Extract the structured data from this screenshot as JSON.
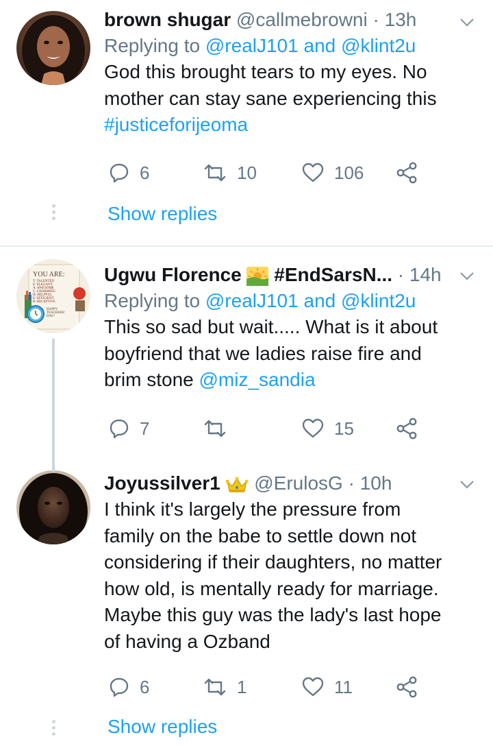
{
  "tweets": [
    {
      "name": "brown shugar",
      "handle": "@callmebrowni",
      "dot": "·",
      "time": "13h",
      "replying_prefix": "Replying to",
      "replying_mention_1": "@realJ101",
      "replying_and": "and",
      "replying_mention_2": "@klint2u",
      "text_1": "God this brought tears to my eyes. No",
      "text_2": "mother can stay sane experiencing this",
      "hashtag": "#justiceforijeoma",
      "replies": "6",
      "retweets": "10",
      "likes": "106",
      "show_replies": "Show replies"
    },
    {
      "name": "Ugwu Florence",
      "name_hashtag": "#EndSarsN...",
      "dot": "·",
      "time": "14h",
      "replying_prefix": "Replying to",
      "replying_mention_1": "@realJ101",
      "replying_and": "and",
      "replying_mention_2": "@klint2u",
      "text_1": "This so sad but wait..... What is it about",
      "text_2": "boyfriend that we ladies raise fire and",
      "text_3": "brim stone",
      "mention": "@miz_sandia",
      "replies": "7",
      "retweets": "",
      "likes": "15",
      "avatar_text": {
        "heading": "YOU ARE:",
        "lines": [
          "T: TALENTED",
          "E: ELEGANT",
          "A: AWESOME",
          "C: CHARMING",
          "H: HELPFUL",
          "E: EFFICIENT",
          "R: RECEPTIVE"
        ],
        "footer_1": "HAPPY",
        "footer_2": "TEACHERS'",
        "footer_3": "DAY!"
      }
    },
    {
      "name": "Joyussilver1",
      "handle": "@ErulosG",
      "dot": "·",
      "time": "10h",
      "text_1": "I think it's largely the pressure from",
      "text_2": "family on the babe to settle down not",
      "text_3": "considering if their daughters, no matter",
      "text_4": "how old, is mentally ready for marriage.",
      "text_5": "Maybe this guy was the lady's last hope",
      "text_6": "of having a Ozband",
      "replies": "6",
      "retweets": "1",
      "likes": "11",
      "show_replies": "Show replies"
    }
  ],
  "colors": {
    "link": "#1da1f2",
    "secondary": "#657786",
    "primary": "#14171a",
    "divider": "#e6ecf0"
  }
}
